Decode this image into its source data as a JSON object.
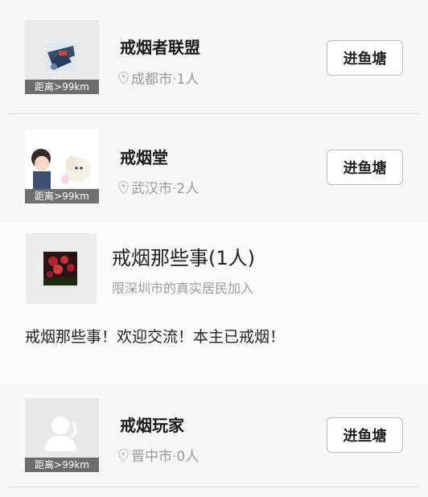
{
  "ponds": [
    {
      "name": "戒烟者联盟",
      "location": "成都市·1人",
      "distance": "距离>99km",
      "button": "进鱼塘"
    },
    {
      "name": "戒烟堂",
      "location": "武汉市·2人",
      "distance": "距离>99km",
      "button": "进鱼塘"
    },
    {
      "name": "戒烟玩家",
      "location": "晋中市·0人",
      "distance": "距离>99km",
      "button": "进鱼塘"
    }
  ],
  "group": {
    "title": "戒烟那些事(1人)",
    "restriction": "限深圳市的真实居民加入",
    "description": "戒烟那些事！欢迎交流！本主已戒烟！"
  },
  "icons": {
    "location": "map-pin-icon",
    "default_avatar": "person-placeholder-icon"
  },
  "colors": {
    "card_bg": "#f7f7f7",
    "muted_text": "#9a9a9a",
    "button_border": "#bdbdbd",
    "distance_tag_bg": "#505050"
  }
}
